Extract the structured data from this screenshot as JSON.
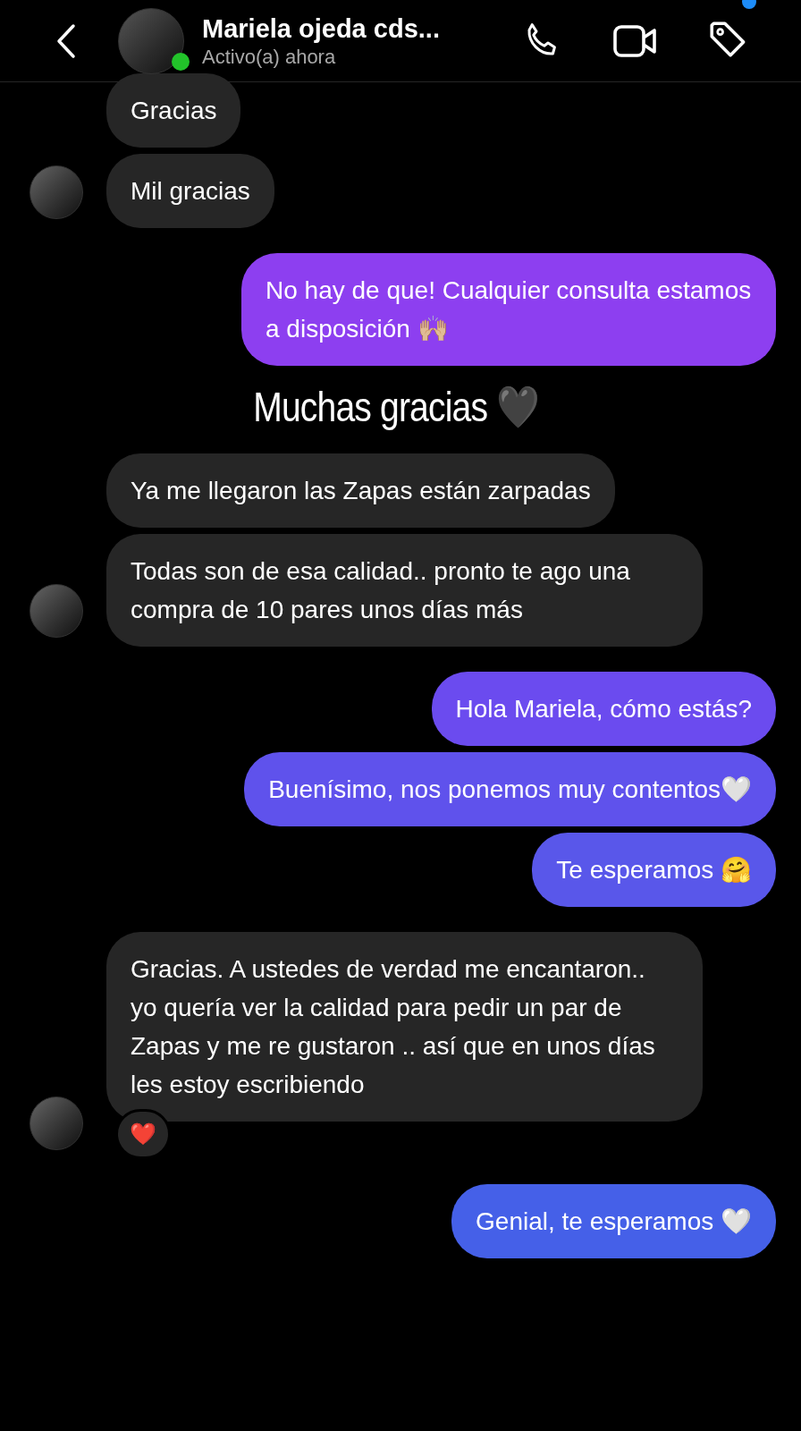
{
  "header": {
    "name": "Mariela ojeda cds...",
    "status": "Activo(a) ahora",
    "online": true,
    "notification_dot": true
  },
  "messages": [
    {
      "kind": "incoming",
      "text": "Gracias"
    },
    {
      "kind": "incoming",
      "text": "Mil gracias"
    },
    {
      "kind": "outgoing",
      "text": "No hay de que! Cualquier consulta estamos a disposición 🙌🏼"
    },
    {
      "kind": "caption",
      "text": "Muchas gracias 🖤"
    },
    {
      "kind": "incoming",
      "text": "Ya me llegaron las Zapas están zarpadas"
    },
    {
      "kind": "incoming",
      "text": "Todas son de esa calidad.. pronto te ago una compra de 10 pares unos días más"
    },
    {
      "kind": "outgoing",
      "text": "Hola Mariela, cómo estás?"
    },
    {
      "kind": "outgoing",
      "text": "Buenísimo, nos ponemos muy contentos🤍"
    },
    {
      "kind": "outgoing",
      "text": "Te esperamos 🤗"
    },
    {
      "kind": "incoming",
      "text": "Gracias. A ustedes  de verdad me encantaron.. yo quería ver la calidad para pedir un par de Zapas y me re gustaron .. así que en unos días les estoy escribiendo",
      "reaction": "❤️"
    },
    {
      "kind": "outgoing",
      "text": "Genial, te esperamos 🤍"
    }
  ]
}
